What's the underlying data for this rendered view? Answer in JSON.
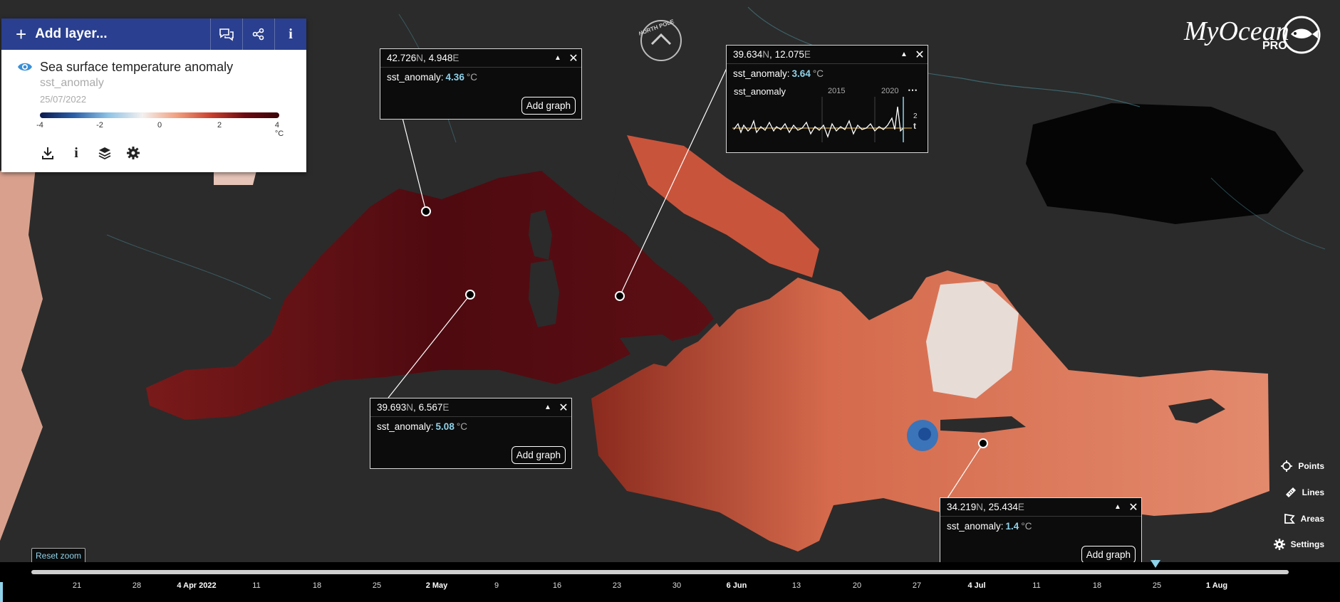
{
  "app": {
    "brand_main": "MyOcean",
    "brand_sub": "PRO"
  },
  "panel": {
    "add_layer_label": "Add layer...",
    "layer_title": "Sea surface temperature anomaly",
    "layer_variable": "sst_anomaly",
    "layer_date": "25/07/2022",
    "colorbar_ticks": [
      "-4",
      "-2",
      "0",
      "2",
      "4 °C"
    ],
    "colorbar_unit": "°C",
    "header_icons": [
      "comment-icon",
      "share-icon",
      "info-icon"
    ],
    "tool_icons": [
      "download-icon",
      "info-icon",
      "layers-icon",
      "settings-icon"
    ]
  },
  "compass": {
    "label": "NORTH POLE"
  },
  "popups": [
    {
      "lat": "42.726",
      "lon": "4.948",
      "var": "sst_anomaly:",
      "value": "4.36",
      "unit": "°C",
      "button": "Add graph"
    },
    {
      "lat": "39.634",
      "lon": "12.075",
      "var": "sst_anomaly:",
      "value": "3.64",
      "unit": "°C",
      "graph_title": "sst_anomaly",
      "graph_years": [
        "2015",
        "2020"
      ],
      "graph_ytick": "2",
      "graph_unit": "t"
    },
    {
      "lat": "39.693",
      "lon": "6.567",
      "var": "sst_anomaly:",
      "value": "5.08",
      "unit": "°C",
      "button": "Add graph"
    },
    {
      "lat": "34.219",
      "lon": "25.434",
      "var": "sst_anomaly:",
      "value": "1.4",
      "unit": "°C",
      "button": "Add graph"
    }
  ],
  "coord_letters": {
    "n": "N",
    "e": "E"
  },
  "right_tools": [
    {
      "label": "Points",
      "icon": "crosshair-icon"
    },
    {
      "label": "Lines",
      "icon": "ruler-icon"
    },
    {
      "label": "Areas",
      "icon": "area-icon"
    },
    {
      "label": "Settings",
      "icon": "settings-icon"
    }
  ],
  "reset_zoom": "Reset zoom",
  "timeline": {
    "labels": [
      "21",
      "28",
      "4 Apr 2022",
      "11",
      "18",
      "25",
      "2 May",
      "9",
      "16",
      "23",
      "30",
      "6 Jun",
      "13",
      "20",
      "27",
      "4 Jul",
      "11",
      "18",
      "25",
      "1 Aug"
    ],
    "selected": "25"
  },
  "colors": {
    "header": "#2a3f8f",
    "accent": "#8fd3ea",
    "land": "#2b2b2b",
    "sea_hot": "#5a0b12",
    "sea_warm": "#d46a4e"
  }
}
